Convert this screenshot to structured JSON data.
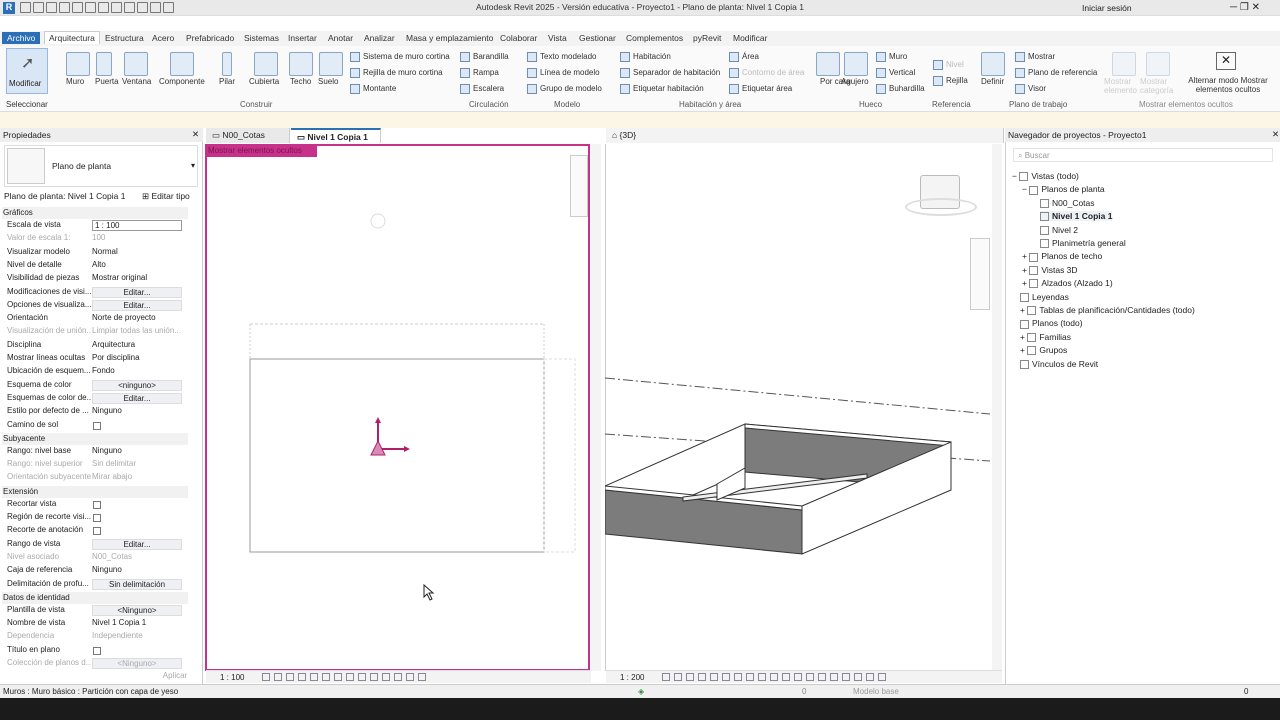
{
  "app": {
    "title": "Autodesk Revit 2025 - Versión educativa - Proyecto1 - Plano de planta: Nivel 1 Copia 1",
    "signin": "Iniciar sesión"
  },
  "tabs": [
    "Archivo",
    "Arquitectura",
    "Estructura",
    "Acero",
    "Prefabricado",
    "Sistemas",
    "Insertar",
    "Anotar",
    "Analizar",
    "Masa y emplazamiento",
    "Colaborar",
    "Vista",
    "Gestionar",
    "Complementos",
    "pyRevit",
    "Modificar"
  ],
  "ribbon": {
    "modify": "Modificar",
    "select": "Seleccionar",
    "build_tools": [
      "Muro",
      "Puerta",
      "Ventana",
      "Componente",
      "Pilar",
      "Cubierta",
      "Techo",
      "Suelo"
    ],
    "build_label": "Construir",
    "curtain": [
      "Sistema de muro cortina",
      "Rejilla de muro cortina",
      "Montante"
    ],
    "circulation": [
      "Barandilla",
      "Rampa",
      "Escalera"
    ],
    "circulation_label": "Circulación",
    "model": [
      "Texto modelado",
      "Línea de modelo",
      "Grupo de modelo"
    ],
    "model_label": "Modelo",
    "room": [
      "Habitación",
      "Separador de habitación",
      "Etiquetar habitación"
    ],
    "area": [
      "Área",
      "Contorno de área",
      "Etiquetar área"
    ],
    "room_label": "Habitación y área",
    "opening": [
      "Por cara",
      "Agujero",
      "Muro",
      "Vertical",
      "Buhardilla"
    ],
    "opening_label": "Hueco",
    "ref": [
      "Nivel",
      "Rejilla"
    ],
    "ref_label": "Referencia",
    "workplane": [
      "Definir",
      "Mostrar",
      "Plano de referencia",
      "Visor"
    ],
    "workplane_label": "Plano de trabajo",
    "hidden": [
      "Mostrar elemento",
      "Mostrar categoría",
      "Alternar modo Mostrar elementos ocultos"
    ],
    "hidden_label": "Mostrar elementos ocultos"
  },
  "properties": {
    "title": "Propiedades",
    "type_name": "Plano de planta",
    "selector": "Plano de planta: Nivel 1 Copia 1",
    "edit_type": "Editar tipo",
    "sections": [
      "Gráficos",
      "Subyacente",
      "Extensión",
      "Datos de identidad"
    ],
    "graphics": [
      [
        "Escala de vista",
        "1 : 100"
      ],
      [
        "Valor de escala    1:",
        "100"
      ],
      [
        "Visualizar modelo",
        "Normal"
      ],
      [
        "Nivel de detalle",
        "Alto"
      ],
      [
        "Visibilidad de piezas",
        "Mostrar original"
      ],
      [
        "Modificaciones de visi...",
        "Editar..."
      ],
      [
        "Opciones de visualiza...",
        "Editar..."
      ],
      [
        "Orientación",
        "Norte de proyecto"
      ],
      [
        "Visualización de unión...",
        "Limpiar todas las unión..."
      ],
      [
        "Disciplina",
        "Arquitectura"
      ],
      [
        "Mostrar líneas ocultas",
        "Por disciplina"
      ],
      [
        "Ubicación de esquem...",
        "Fondo"
      ],
      [
        "Esquema de color",
        "<ninguno>"
      ],
      [
        "Esquemas de color de...",
        "Editar..."
      ],
      [
        "Estilo por defecto de ...",
        "Ninguno"
      ],
      [
        "Camino de sol",
        ""
      ]
    ],
    "underlay": [
      [
        "Rango: nivel base",
        "Ninguno"
      ],
      [
        "Rango: nivel superior",
        "Sin delimitar"
      ],
      [
        "Orientación subyacente",
        "Mirar abajo"
      ]
    ],
    "extents": [
      [
        "Recortar vista",
        ""
      ],
      [
        "Región de recorte visi...",
        ""
      ],
      [
        "Recorte de anotación",
        ""
      ],
      [
        "Rango de vista",
        "Editar..."
      ],
      [
        "Nivel asociado",
        "N00_Cotas"
      ],
      [
        "Caja de referencia",
        "Ninguno"
      ],
      [
        "Delimitación de profu...",
        "Sin delimitación"
      ]
    ],
    "identity": [
      [
        "Plantilla de vista",
        "<Ninguno>"
      ],
      [
        "Nombre de vista",
        "Nivel 1 Copia 1"
      ],
      [
        "Dependencia",
        "Independiente"
      ],
      [
        "Título en plano",
        ""
      ],
      [
        "Colección de planos d...",
        "<Ninguno>"
      ]
    ],
    "apply": "Aplicar"
  },
  "views": {
    "tab1": "N00_Cotas",
    "tab2": "Nivel 1 Copia 1",
    "tab3": "{3D}",
    "banner": "Mostrar elementos ocultos",
    "scale_plan": "1 : 100",
    "scale_3d": "1 : 200"
  },
  "browser": {
    "title": "Navegador de proyectos - Proyecto1",
    "search": "Buscar",
    "items": [
      "Vistas (todo)",
      "Planos de planta",
      "N00_Cotas",
      "Nivel 1 Copia 1",
      "Nivel 2",
      "Planimetría general",
      "Planos de techo",
      "Vistas 3D",
      "Alzados (Alzado 1)",
      "Leyendas",
      "Tablas de planificación/Cantidades (todo)",
      "Planos (todo)",
      "Familias",
      "Grupos",
      "Vínculos de Revit"
    ]
  },
  "status": {
    "text": "Muros : Muro básico : Partición con capa de yeso",
    "model": "Modelo base",
    "zero": "0"
  }
}
